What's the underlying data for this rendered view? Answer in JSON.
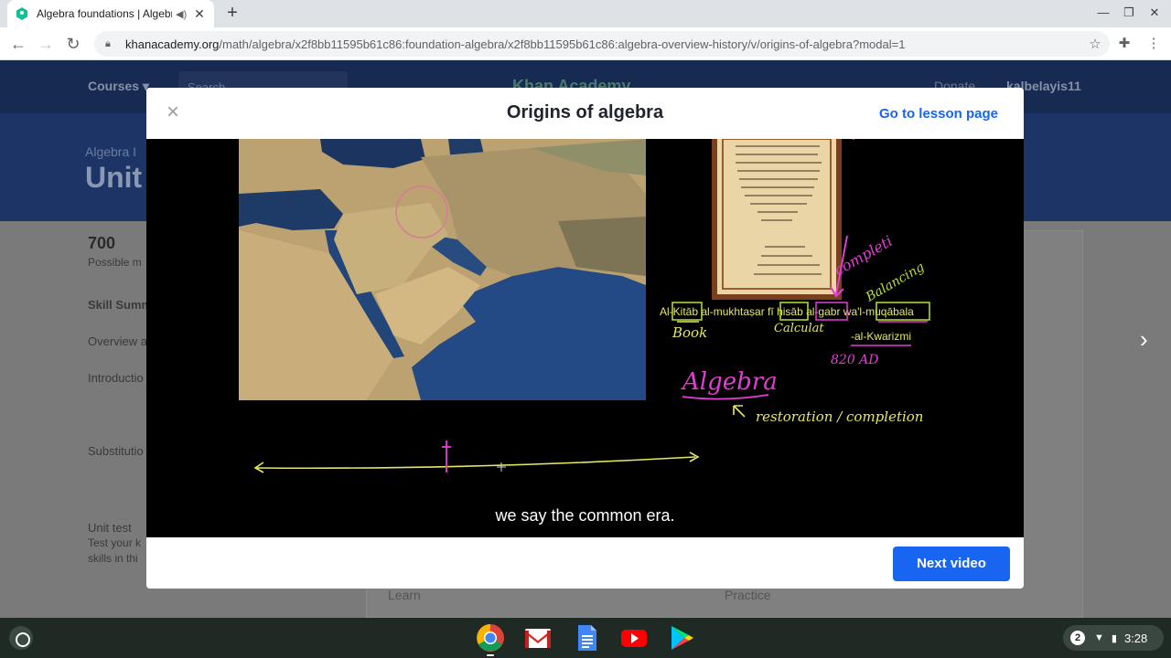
{
  "browser": {
    "tab_title": "Algebra foundations | Algebra I",
    "url_host": "khanacademy.org",
    "url_path": "/math/algebra/x2f8bb11595b61c86:foundation-algebra/x2f8bb11595b61c86:algebra-overview-history/v/origins-of-algebra?modal=1"
  },
  "page": {
    "courses": "Courses",
    "search_placeholder": "Search",
    "logo": "Khan Academy",
    "donate": "Donate",
    "username": "kalbelayis11",
    "breadcrumb": "Algebra I",
    "unit_title": "Unit",
    "points": "700",
    "points_label": "Possible m",
    "skill_summary": "Skill Summ",
    "overview": "Overview a",
    "introduction": "Introductio",
    "substitution": "Substitutio",
    "unit_test": "Unit test",
    "unit_test_desc1": "Test your k",
    "unit_test_desc2": "skills in thi",
    "learn": "Learn",
    "practice": "Practice"
  },
  "modal": {
    "title": "Origins of algebra",
    "lesson_link": "Go to lesson page",
    "caption": "we say the common era.",
    "next_button": "Next video"
  },
  "video": {
    "transliteration": {
      "t1": "Al-",
      "t2": "Kitāb",
      "t3": " al-mukhtaṣar fī ",
      "t4": "ḥisāb",
      "t5": " al-",
      "t6": "gabr",
      "t7": " wa'l-",
      "t8": "muqābala"
    },
    "label_book": "Book",
    "label_calculation": "Calculat",
    "label_completion": "completi",
    "label_balancing": "Balancing",
    "label_author": "-al-Kwarizmi",
    "label_year": "820 AD",
    "label_algebra": "Algebra",
    "label_meaning": "restoration / completion"
  },
  "system": {
    "notification_count": "2",
    "time": "3:28"
  },
  "colors": {
    "ka_navy": "#172a52",
    "ka_blue": "#1865f2",
    "pen_yellow": "#e6e860",
    "pen_magenta": "#e63cd6",
    "pen_green": "#b8e23a"
  }
}
